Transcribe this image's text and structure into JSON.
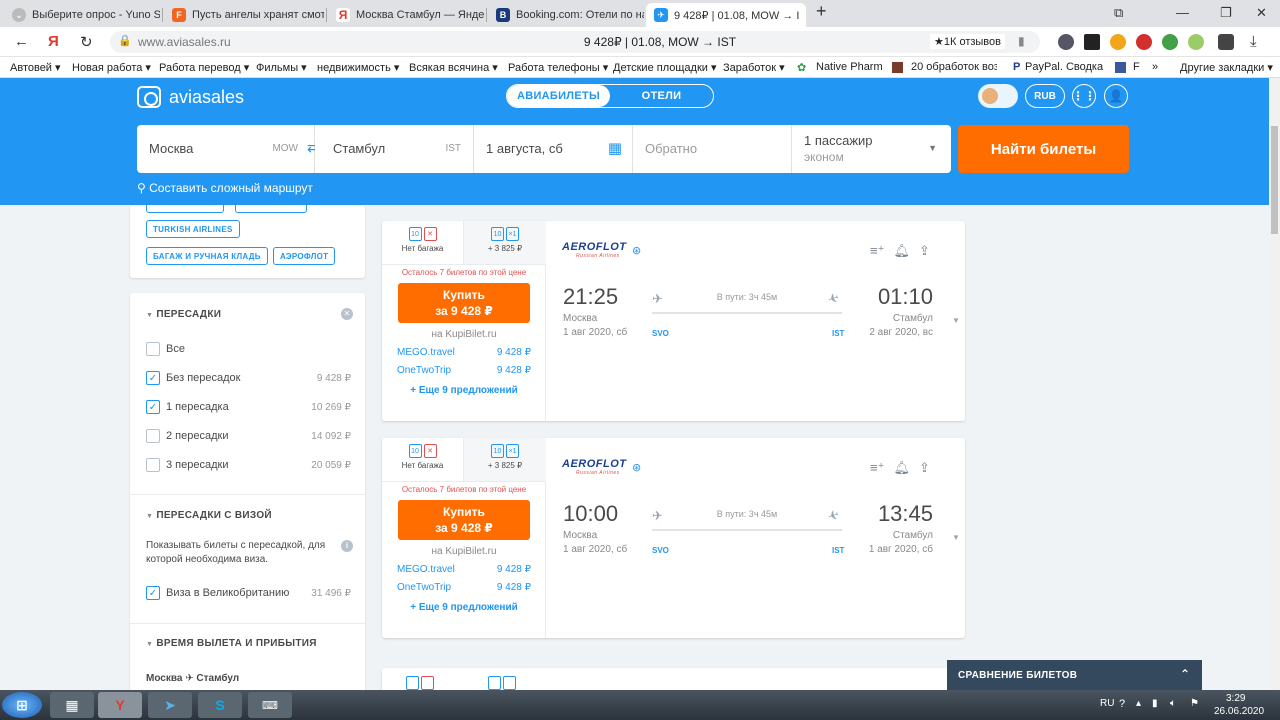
{
  "browser": {
    "tabs": [
      {
        "title": "Выберите опрос - Yuno Su",
        "active": false,
        "icon": "yuno-icon"
      },
      {
        "title": "Пусть ангелы хранят смотр",
        "active": false,
        "icon": "f-icon"
      },
      {
        "title": "Москва Стамбул — Яндекс",
        "active": false,
        "icon": "yandex-icon"
      },
      {
        "title": "Booking.com: Отели по на",
        "active": false,
        "icon": "booking-icon"
      },
      {
        "title": "9 428₽ | 01.08, MOW → I",
        "active": true,
        "icon": "aviasales-icon"
      }
    ],
    "url": "www.aviasales.ru",
    "page_title": "9 428₽ | 01.08, MOW → IST",
    "reviews_badge": "★1К отзывов",
    "bookmarks": [
      "Автовей ▾",
      "Новая работа ▾",
      "Работа перевод ▾",
      "Фильмы ▾",
      "недвижимость ▾",
      "Всякая всячина ▾",
      "Работа телефоны ▾",
      "Детские площадки ▾",
      "Заработок ▾",
      "Native Pharm",
      "20 обработок воз",
      "PayPal. Сводка",
      "F",
      "»",
      "Другие закладки ▾"
    ]
  },
  "header": {
    "logo": "aviasales",
    "tab_flights": "АВИАБИЛЕТЫ",
    "tab_hotels": "ОТЕЛИ",
    "currency": "RUB"
  },
  "search": {
    "origin": "Москва",
    "origin_code": "MOW",
    "destination": "Стамбул",
    "destination_code": "IST",
    "depart_date": "1 августа, сб",
    "return_placeholder": "Обратно",
    "passengers": "1 пассажир",
    "cabin": "эконом",
    "find_button": "Найти билеты",
    "complex_route": "Составить сложный маршрут"
  },
  "filters": {
    "airline_tags": [
      "TURKISH AIRLINES",
      "БАГАЖ И РУЧНАЯ КЛАДЬ",
      "АЭРОФЛОТ"
    ],
    "stops": {
      "title": "ПЕРЕСАДКИ",
      "options": [
        {
          "label": "Все",
          "checked": false,
          "price": ""
        },
        {
          "label": "Без пересадок",
          "checked": true,
          "price": "9 428 ₽"
        },
        {
          "label": "1 пересадка",
          "checked": true,
          "price": "10 269 ₽"
        },
        {
          "label": "2 пересадки",
          "checked": false,
          "price": "14 092 ₽"
        },
        {
          "label": "3 пересадки",
          "checked": false,
          "price": "20 059 ₽"
        }
      ]
    },
    "visa": {
      "title": "ПЕРЕСАДКИ С ВИЗОЙ",
      "desc": "Показывать билеты с пересадкой, для которой необходима виза.",
      "option_label": "Виза в Великобританию",
      "option_price": "31 496 ₽",
      "checked": true
    },
    "times": {
      "title": "ВРЕМЯ ВЫЛЕТА И ПРИБЫТИЯ",
      "route": "Москва ✈ Стамбул"
    }
  },
  "tickets": [
    {
      "bag1_label": "Нет багажа",
      "bag2_label": "+ 3 825 ₽",
      "seats_left": "Осталось 7 билетов по этой цене",
      "buy_line1": "Купить",
      "buy_line2": "за 9 428 ₽",
      "via": "на KupiBilet.ru",
      "agents": [
        {
          "name": "MEGO.travel",
          "price": "9 428 ₽"
        },
        {
          "name": "OneTwoTrip",
          "price": "9 428 ₽"
        }
      ],
      "more": "+ Еще 9 предложений",
      "airline": "AEROFLOT",
      "airline_sub": "Russian Airlines",
      "depart_time": "21:25",
      "depart_city": "Москва",
      "depart_date": "1 авг 2020, сб",
      "depart_code": "SVO",
      "duration": "В пути: 3ч 45м",
      "arrive_time": "01:10",
      "arrive_city": "Стамбул",
      "arrive_date": "2 авг 2020, вс",
      "arrive_code": "IST"
    },
    {
      "bag1_label": "Нет багажа",
      "bag2_label": "+ 3 825 ₽",
      "seats_left": "Осталось 7 билетов по этой цене",
      "buy_line1": "Купить",
      "buy_line2": "за 9 428 ₽",
      "via": "на KupiBilet.ru",
      "agents": [
        {
          "name": "MEGO.travel",
          "price": "9 428 ₽"
        },
        {
          "name": "OneTwoTrip",
          "price": "9 428 ₽"
        }
      ],
      "more": "+ Еще 9 предложений",
      "airline": "AEROFLOT",
      "airline_sub": "Russian Airlines",
      "depart_time": "10:00",
      "depart_city": "Москва",
      "depart_date": "1 авг 2020, сб",
      "depart_code": "SVO",
      "duration": "В пути: 3ч 45м",
      "arrive_time": "13:45",
      "arrive_city": "Стамбул",
      "arrive_date": "1 авг 2020, сб",
      "arrive_code": "IST"
    }
  ],
  "compare_bar": "СРАВНЕНИЕ БИЛЕТОВ",
  "taskbar": {
    "lang": "RU",
    "time": "3:29",
    "date": "26.06.2020"
  },
  "colors": {
    "brand_blue": "#2196f3",
    "cta_orange": "#ff6d00",
    "alert_red": "#e05050"
  }
}
